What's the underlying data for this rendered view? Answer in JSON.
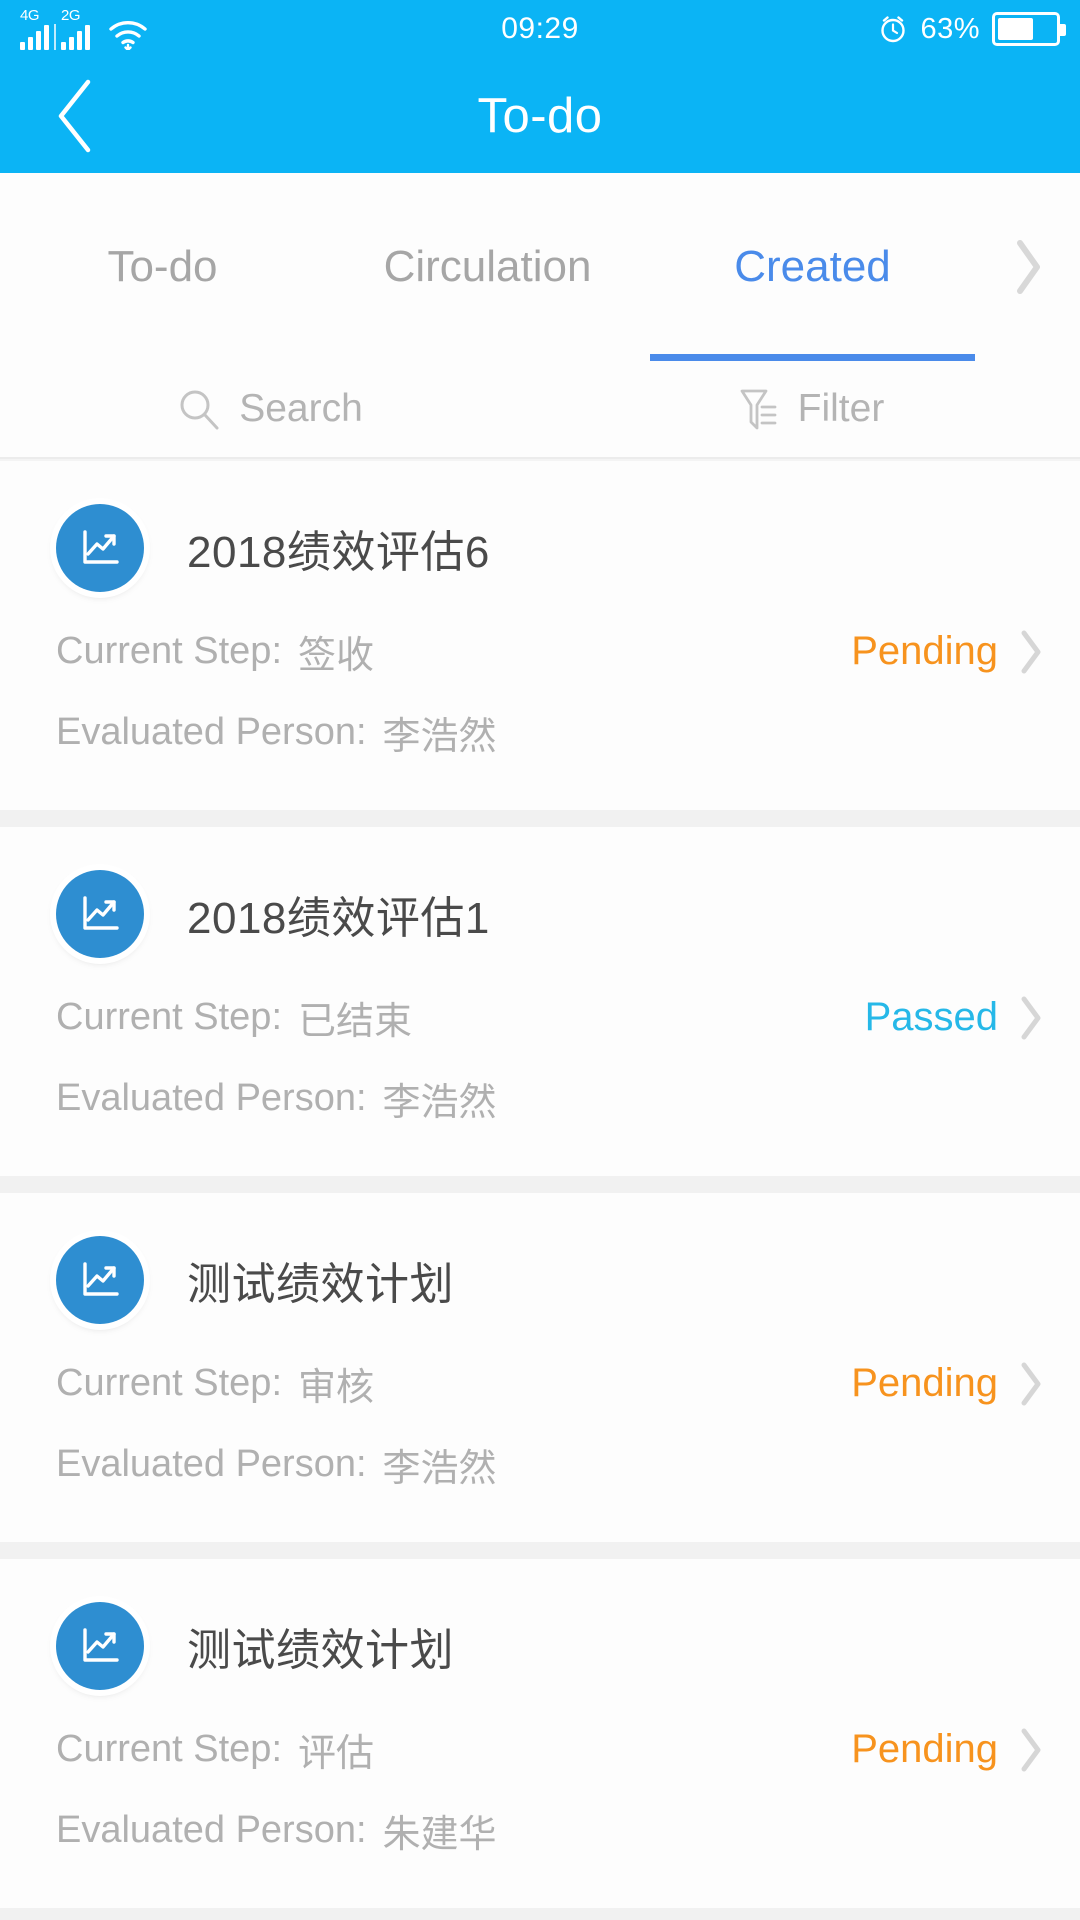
{
  "statusbar": {
    "network_primary": "4G",
    "network_secondary": "2G",
    "wifi_icon": "wifi-icon",
    "time": "09:29",
    "alarm_icon": "alarm-clock-icon",
    "battery_percent": "63%",
    "battery_level": 63
  },
  "header": {
    "back_icon": "chevron-left-icon",
    "title": "To-do"
  },
  "tabs": {
    "items": [
      {
        "label": "To-do",
        "active": false
      },
      {
        "label": "Circulation",
        "active": false
      },
      {
        "label": "Created",
        "active": true
      }
    ],
    "more_icon": "chevron-right-icon",
    "active_color": "#4a8bea",
    "inactive_color": "#a6a6a6"
  },
  "tools": {
    "search_icon": "search-icon",
    "search_label": "Search",
    "filter_icon": "filter-icon",
    "filter_label": "Filter"
  },
  "labels": {
    "current_step": "Current Step:",
    "evaluated_person": "Evaluated Person:"
  },
  "colors": {
    "brand_blue": "#0bb4f5",
    "tab_blue": "#4a8bea",
    "status_pending": "#f7931e",
    "status_passed": "#26b8e8",
    "avatar_blue": "#2e8ed1"
  },
  "list": {
    "items": [
      {
        "icon": "line-chart-icon",
        "title": "2018绩效评估6",
        "current_step": "签收",
        "evaluated_person": "李浩然",
        "status": "Pending",
        "status_type": "pending",
        "chevron_icon": "chevron-right-icon"
      },
      {
        "icon": "line-chart-icon",
        "title": "2018绩效评估1",
        "current_step": "已结束",
        "evaluated_person": "李浩然",
        "status": "Passed",
        "status_type": "passed",
        "chevron_icon": "chevron-right-icon"
      },
      {
        "icon": "line-chart-icon",
        "title": "测试绩效计划",
        "current_step": "审核",
        "evaluated_person": "李浩然",
        "status": "Pending",
        "status_type": "pending",
        "chevron_icon": "chevron-right-icon"
      },
      {
        "icon": "line-chart-icon",
        "title": "测试绩效计划",
        "current_step": "评估",
        "evaluated_person": "朱建华",
        "status": "Pending",
        "status_type": "pending",
        "chevron_icon": "chevron-right-icon"
      }
    ]
  }
}
